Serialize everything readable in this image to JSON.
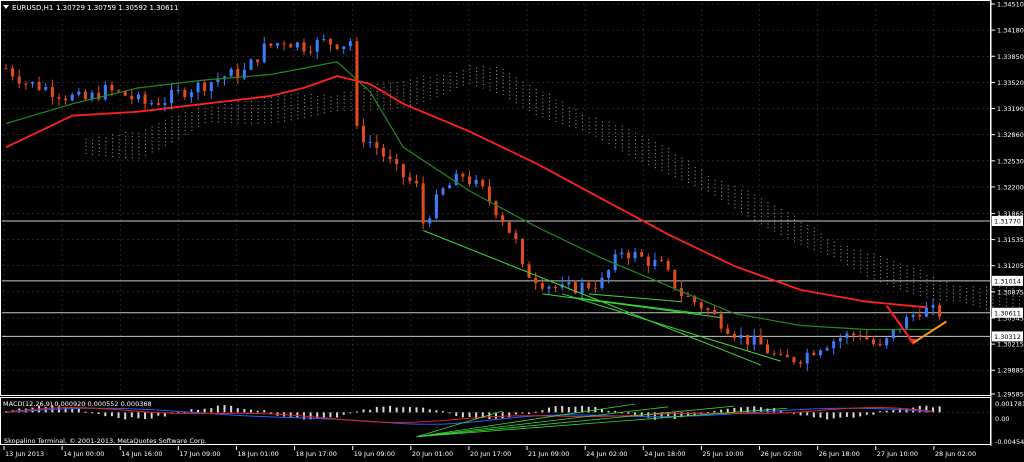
{
  "header": {
    "symbol": "EURUSD,H1",
    "ohlc": "1.30729 1.30759 1.30592 1.30611"
  },
  "macd": {
    "label": "MACD(12,26,9) 0.000920 0.000552 0.000368",
    "ticks": [
      "0.001781",
      "0.00",
      "-0.004544"
    ]
  },
  "footer": {
    "copyright": "Skopalino Terminal, © 2001-2013, MetaQuotes Software Corp."
  },
  "colors": {
    "background": "#000000",
    "bull": "#3d7bff",
    "bear": "#e34a20",
    "ma_red": "#ff2020",
    "ma_green": "#1f8a1f",
    "cloud": "#d9c7c0",
    "trend": "#39d939",
    "arrow_red": "#ff2020",
    "arrow_orange": "#ff9a1a",
    "grid": "#3a3a3a",
    "axis_text": "#ffffff"
  },
  "chart_data": {
    "type": "candlestick",
    "ylim": [
      1.29585,
      1.3451
    ],
    "y_ticks": [
      "1.34510",
      "1.34180",
      "1.33850",
      "1.33520",
      "1.33190",
      "1.32860",
      "1.32530",
      "1.32200",
      "1.31865",
      "1.31535",
      "1.31205",
      "1.30875",
      "1.30545",
      "1.30215",
      "1.29885",
      "1.29585"
    ],
    "highlighted_levels": [
      {
        "label": "1.31770",
        "value": 1.3177
      },
      {
        "label": "1.31014",
        "value": 1.31014
      },
      {
        "label": "1.30611",
        "value": 1.30611
      },
      {
        "label": "1.30312",
        "value": 1.30312
      }
    ],
    "x_labels": [
      "13 Jun 2013",
      "14 Jun 00:00",
      "14 Jun 16:00",
      "17 Jun 09:00",
      "18 Jun 01:00",
      "18 Jun 17:00",
      "19 Jun 09:00",
      "20 Jun 01:00",
      "20 Jun 17:00",
      "21 Jun 09:00",
      "24 Jun 02:00",
      "24 Jun 18:00",
      "25 Jun 10:00",
      "26 Jun 02:00",
      "26 Jun 18:00",
      "27 Jun 10:00",
      "28 Jun 02:00"
    ],
    "price_path": [
      [
        0,
        1.337
      ],
      [
        3,
        1.3352
      ],
      [
        6,
        1.3345
      ],
      [
        9,
        1.3335
      ],
      [
        12,
        1.333
      ],
      [
        15,
        1.3342
      ],
      [
        18,
        1.3336
      ],
      [
        21,
        1.3325
      ],
      [
        24,
        1.333
      ],
      [
        27,
        1.3342
      ],
      [
        30,
        1.335
      ],
      [
        33,
        1.336
      ],
      [
        36,
        1.3365
      ],
      [
        39,
        1.3395
      ],
      [
        42,
        1.3405
      ],
      [
        45,
        1.3398
      ],
      [
        48,
        1.3403
      ],
      [
        51,
        1.3401
      ],
      [
        52,
        1.3405
      ],
      [
        53,
        1.329
      ],
      [
        56,
        1.327
      ],
      [
        59,
        1.324
      ],
      [
        62,
        1.322
      ],
      [
        63,
        1.3175
      ],
      [
        66,
        1.3215
      ],
      [
        69,
        1.3235
      ],
      [
        72,
        1.3215
      ],
      [
        75,
        1.318
      ],
      [
        77,
        1.315
      ],
      [
        78,
        1.3115
      ],
      [
        81,
        1.31
      ],
      [
        84,
        1.309
      ],
      [
        87,
        1.3095
      ],
      [
        90,
        1.31
      ],
      [
        93,
        1.314
      ],
      [
        96,
        1.313
      ],
      [
        99,
        1.312
      ],
      [
        102,
        1.3085
      ],
      [
        105,
        1.307
      ],
      [
        108,
        1.305
      ],
      [
        111,
        1.303
      ],
      [
        114,
        1.302
      ],
      [
        117,
        1.3
      ],
      [
        120,
        1.3005
      ],
      [
        123,
        1.302
      ],
      [
        126,
        1.303
      ],
      [
        129,
        1.3035
      ],
      [
        132,
        1.3015
      ],
      [
        135,
        1.3045
      ],
      [
        138,
        1.3065
      ],
      [
        141,
        1.3061
      ]
    ],
    "ma_red": [
      [
        0,
        1.327
      ],
      [
        10,
        1.331
      ],
      [
        20,
        1.3315
      ],
      [
        30,
        1.3325
      ],
      [
        40,
        1.3335
      ],
      [
        45,
        1.3345
      ],
      [
        50,
        1.336
      ],
      [
        55,
        1.335
      ],
      [
        60,
        1.3325
      ],
      [
        70,
        1.329
      ],
      [
        80,
        1.325
      ],
      [
        90,
        1.3205
      ],
      [
        100,
        1.316
      ],
      [
        110,
        1.312
      ],
      [
        120,
        1.309
      ],
      [
        130,
        1.3075
      ],
      [
        139,
        1.3068
      ]
    ],
    "ma_green": [
      [
        0,
        1.33
      ],
      [
        10,
        1.3325
      ],
      [
        20,
        1.3345
      ],
      [
        30,
        1.3355
      ],
      [
        40,
        1.3362
      ],
      [
        50,
        1.3378
      ],
      [
        55,
        1.334
      ],
      [
        60,
        1.327
      ],
      [
        70,
        1.3215
      ],
      [
        80,
        1.317
      ],
      [
        90,
        1.313
      ],
      [
        100,
        1.3095
      ],
      [
        110,
        1.306
      ],
      [
        120,
        1.3045
      ],
      [
        130,
        1.304
      ],
      [
        140,
        1.304
      ]
    ],
    "trend_lines": [
      [
        [
          63,
          1.3165
        ],
        [
          114,
          1.2995
        ]
      ],
      [
        [
          81,
          1.3085
        ],
        [
          108,
          1.3055
        ]
      ],
      [
        [
          84,
          1.3085
        ],
        [
          117,
          1.3
        ]
      ],
      [
        [
          86,
          1.308
        ],
        [
          105,
          1.306
        ]
      ],
      [
        [
          88,
          1.3085
        ],
        [
          102,
          1.3075
        ]
      ]
    ],
    "forecast_arrows": [
      {
        "color": "red",
        "from": [
          133,
          1.307
        ],
        "to": [
          137,
          1.3023
        ]
      },
      {
        "color": "orange",
        "from": [
          137,
          1.3023
        ],
        "to": [
          142,
          1.305
        ]
      }
    ],
    "macd_histogram_range": [
      -0.004544,
      0.001781
    ]
  }
}
